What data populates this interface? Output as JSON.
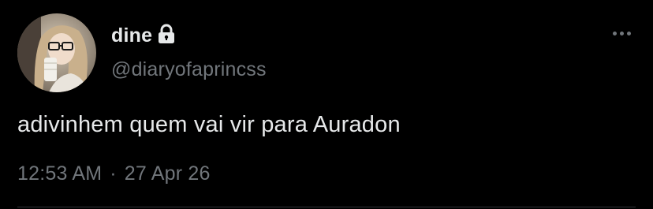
{
  "user": {
    "display_name": "dine",
    "handle": "@diaryofaprincss",
    "avatar": "profile-photo",
    "locked_icon": "lock-icon"
  },
  "tweet": {
    "text": "adivinhem quem vai vir para Auradon",
    "time": "12:53 AM",
    "separator": "·",
    "date": "27 Apr 26"
  },
  "actions": {
    "more_icon": "more-horizontal-icon"
  },
  "colors": {
    "background": "#000000",
    "primary_text": "#e7e9ea",
    "secondary_text": "#71767b",
    "divider": "#2f3336"
  }
}
